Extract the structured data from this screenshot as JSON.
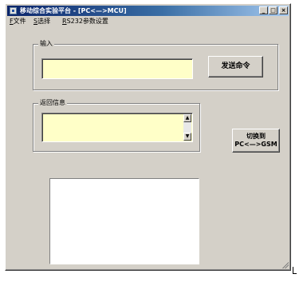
{
  "window": {
    "title": "移动综合实验平台 - [PC<—>MCU]",
    "controls": {
      "minimize": "_",
      "maximize": "□",
      "close": "×"
    }
  },
  "menubar": {
    "items": [
      {
        "hotkey": "F",
        "label": "文件"
      },
      {
        "hotkey": "S",
        "label": "选择"
      },
      {
        "hotkey": "R",
        "label": "S232参数设置"
      }
    ]
  },
  "input_group": {
    "label": "输入",
    "value": "",
    "send_button_label": "发送命令"
  },
  "return_group": {
    "label": "返回信息",
    "value": "",
    "scroll_up": "▲",
    "scroll_down": "▼"
  },
  "switch_button": {
    "line1": "切换到",
    "line2": "PC<—>GSM"
  },
  "colors": {
    "window_bg": "#d4d0c8",
    "field_bg": "#ffffc8",
    "title_start": "#0a246a",
    "title_end": "#a6caf0"
  },
  "icons": [
    "app-icon",
    "minimize-icon",
    "maximize-icon",
    "close-icon",
    "scroll-up-icon",
    "scroll-down-icon",
    "resize-grip-icon"
  ]
}
